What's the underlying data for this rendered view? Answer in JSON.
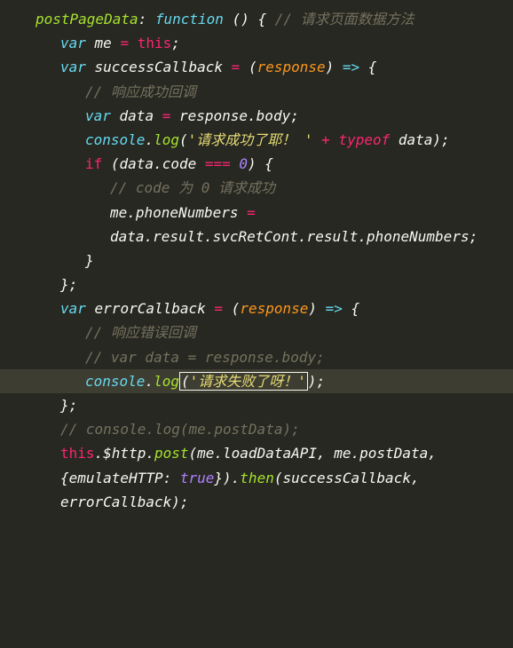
{
  "code": {
    "funcName": "postPageData",
    "functionKw": "function",
    "emptyParens": " () {",
    "commentTop": " // 请求页面数据方法",
    "var": "var",
    "me": " me ",
    "eq": "=",
    "thisKw": " this",
    "semi": ";",
    "successCallback": " successCallback ",
    "arrowParamOpen": " (",
    "response": "response",
    "arrowParamClose": ") ",
    "arrow": "=>",
    "openBrace": " {",
    "commentSuccess": "// 响应成功回调",
    "data": " data ",
    "responseBody": " response.body;",
    "console": "console",
    "dot": ".",
    "log": "log",
    "strSuccess": "'请求成功了耶！ '",
    "plus": " + ",
    "typeof": "typeof",
    "dataPlain": " data);",
    "if": "if",
    "condOpen": " (data.code ",
    "tripleEq": "===",
    "zero": " 0",
    "condClose": ") {",
    "commentCode0": "// code 为 0 请求成功",
    "mePhone": "me.phoneNumbers ",
    "dataResult": "data.result.svcRetCont.result.phoneNumbers;",
    "closeBrace": "}",
    "closeBraceSemi": "};",
    "errorCallback": " errorCallback ",
    "commentError": "// 响应错误回调",
    "commentVarData": "// var data = response.body;",
    "strFailPre": "(",
    "strFail": "'请求失败了呀！'",
    "strFailPost": ");",
    "commentConsoleLog": "// console.log(me.postData);",
    "thisHttp": "this",
    "httpProp": ".$http.",
    "post": "post",
    "postArgs1": "(me.loadDataAPI, me.postData, {emulateHTTP: ",
    "true": "true",
    "postArgs2": "}).",
    "then": "then",
    "thenArgs": "(successCallback, errorCallback);"
  }
}
